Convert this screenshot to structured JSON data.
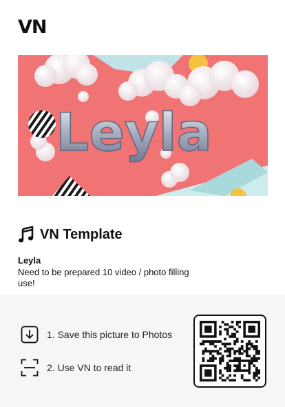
{
  "brand": {
    "logo_text": "VN"
  },
  "banner": {
    "balloon_text": "Leyla"
  },
  "template": {
    "heading": "VN Template",
    "name": "Leyla",
    "description": "Need to be prepared 10 video / photo filling use!"
  },
  "steps": [
    {
      "label": "1. Save this picture to Photos",
      "icon": "download-icon"
    },
    {
      "label": "2. Use VN to read it",
      "icon": "scan-icon"
    }
  ],
  "qr": {
    "icon": "qr-code"
  },
  "colors": {
    "banner_bg": "#f07474",
    "bottom_bg": "#f6f6f6",
    "text": "#111111"
  }
}
